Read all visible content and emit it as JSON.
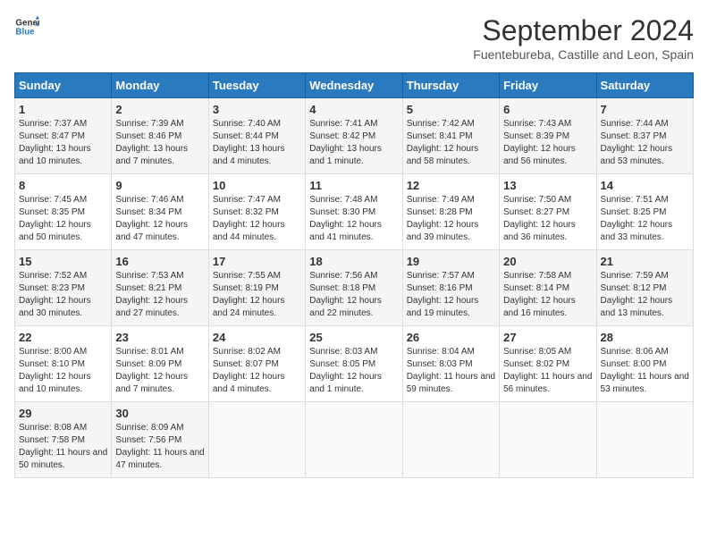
{
  "header": {
    "logo_general": "General",
    "logo_blue": "Blue",
    "month_title": "September 2024",
    "location": "Fuentebureba, Castille and Leon, Spain"
  },
  "days_of_week": [
    "Sunday",
    "Monday",
    "Tuesday",
    "Wednesday",
    "Thursday",
    "Friday",
    "Saturday"
  ],
  "weeks": [
    [
      {
        "day": "1",
        "sunrise": "7:37 AM",
        "sunset": "8:47 PM",
        "daylight": "13 hours and 10 minutes."
      },
      {
        "day": "2",
        "sunrise": "7:39 AM",
        "sunset": "8:46 PM",
        "daylight": "13 hours and 7 minutes."
      },
      {
        "day": "3",
        "sunrise": "7:40 AM",
        "sunset": "8:44 PM",
        "daylight": "13 hours and 4 minutes."
      },
      {
        "day": "4",
        "sunrise": "7:41 AM",
        "sunset": "8:42 PM",
        "daylight": "13 hours and 1 minute."
      },
      {
        "day": "5",
        "sunrise": "7:42 AM",
        "sunset": "8:41 PM",
        "daylight": "12 hours and 58 minutes."
      },
      {
        "day": "6",
        "sunrise": "7:43 AM",
        "sunset": "8:39 PM",
        "daylight": "12 hours and 56 minutes."
      },
      {
        "day": "7",
        "sunrise": "7:44 AM",
        "sunset": "8:37 PM",
        "daylight": "12 hours and 53 minutes."
      }
    ],
    [
      {
        "day": "8",
        "sunrise": "7:45 AM",
        "sunset": "8:35 PM",
        "daylight": "12 hours and 50 minutes."
      },
      {
        "day": "9",
        "sunrise": "7:46 AM",
        "sunset": "8:34 PM",
        "daylight": "12 hours and 47 minutes."
      },
      {
        "day": "10",
        "sunrise": "7:47 AM",
        "sunset": "8:32 PM",
        "daylight": "12 hours and 44 minutes."
      },
      {
        "day": "11",
        "sunrise": "7:48 AM",
        "sunset": "8:30 PM",
        "daylight": "12 hours and 41 minutes."
      },
      {
        "day": "12",
        "sunrise": "7:49 AM",
        "sunset": "8:28 PM",
        "daylight": "12 hours and 39 minutes."
      },
      {
        "day": "13",
        "sunrise": "7:50 AM",
        "sunset": "8:27 PM",
        "daylight": "12 hours and 36 minutes."
      },
      {
        "day": "14",
        "sunrise": "7:51 AM",
        "sunset": "8:25 PM",
        "daylight": "12 hours and 33 minutes."
      }
    ],
    [
      {
        "day": "15",
        "sunrise": "7:52 AM",
        "sunset": "8:23 PM",
        "daylight": "12 hours and 30 minutes."
      },
      {
        "day": "16",
        "sunrise": "7:53 AM",
        "sunset": "8:21 PM",
        "daylight": "12 hours and 27 minutes."
      },
      {
        "day": "17",
        "sunrise": "7:55 AM",
        "sunset": "8:19 PM",
        "daylight": "12 hours and 24 minutes."
      },
      {
        "day": "18",
        "sunrise": "7:56 AM",
        "sunset": "8:18 PM",
        "daylight": "12 hours and 22 minutes."
      },
      {
        "day": "19",
        "sunrise": "7:57 AM",
        "sunset": "8:16 PM",
        "daylight": "12 hours and 19 minutes."
      },
      {
        "day": "20",
        "sunrise": "7:58 AM",
        "sunset": "8:14 PM",
        "daylight": "12 hours and 16 minutes."
      },
      {
        "day": "21",
        "sunrise": "7:59 AM",
        "sunset": "8:12 PM",
        "daylight": "12 hours and 13 minutes."
      }
    ],
    [
      {
        "day": "22",
        "sunrise": "8:00 AM",
        "sunset": "8:10 PM",
        "daylight": "12 hours and 10 minutes."
      },
      {
        "day": "23",
        "sunrise": "8:01 AM",
        "sunset": "8:09 PM",
        "daylight": "12 hours and 7 minutes."
      },
      {
        "day": "24",
        "sunrise": "8:02 AM",
        "sunset": "8:07 PM",
        "daylight": "12 hours and 4 minutes."
      },
      {
        "day": "25",
        "sunrise": "8:03 AM",
        "sunset": "8:05 PM",
        "daylight": "12 hours and 1 minute."
      },
      {
        "day": "26",
        "sunrise": "8:04 AM",
        "sunset": "8:03 PM",
        "daylight": "11 hours and 59 minutes."
      },
      {
        "day": "27",
        "sunrise": "8:05 AM",
        "sunset": "8:02 PM",
        "daylight": "11 hours and 56 minutes."
      },
      {
        "day": "28",
        "sunrise": "8:06 AM",
        "sunset": "8:00 PM",
        "daylight": "11 hours and 53 minutes."
      }
    ],
    [
      {
        "day": "29",
        "sunrise": "8:08 AM",
        "sunset": "7:58 PM",
        "daylight": "11 hours and 50 minutes."
      },
      {
        "day": "30",
        "sunrise": "8:09 AM",
        "sunset": "7:56 PM",
        "daylight": "11 hours and 47 minutes."
      },
      null,
      null,
      null,
      null,
      null
    ]
  ],
  "labels": {
    "sunrise": "Sunrise:",
    "sunset": "Sunset:",
    "daylight": "Daylight:"
  }
}
